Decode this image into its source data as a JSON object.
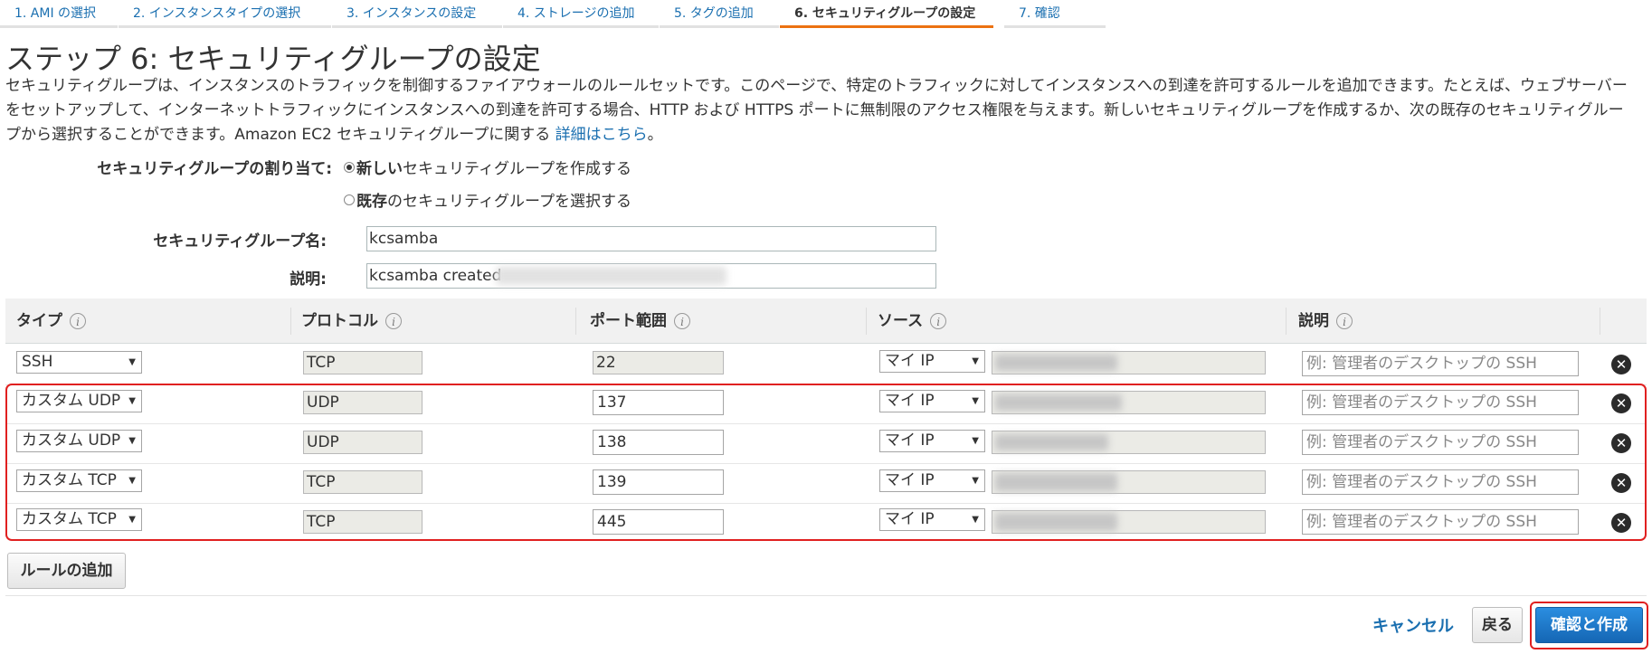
{
  "tabs": [
    {
      "label": "1. AMI の選択",
      "active": false
    },
    {
      "label": "2. インスタンスタイプの選択",
      "active": false
    },
    {
      "label": "3. インスタンスの設定",
      "active": false
    },
    {
      "label": "4. ストレージの追加",
      "active": false
    },
    {
      "label": "5. タグの追加",
      "active": false
    },
    {
      "label": "6. セキュリティグループの設定",
      "active": true
    },
    {
      "label": "7. 確認",
      "active": false
    }
  ],
  "page": {
    "title": "ステップ 6: セキュリティグループの設定",
    "intro": "セキュリティグループは、インスタンスのトラフィックを制御するファイアウォールのルールセットです。このページで、特定のトラフィックに対してインスタンスへの到達を許可するルールを追加できます。たとえば、ウェブサーバーをセットアップして、インターネットトラフィックにインスタンスへの到達を許可する場合、HTTP および HTTPS ポートに無制限のアクセス権限を与えます。新しいセキュリティグループを作成するか、次の既存のセキュリティグループから選択することができます。Amazon EC2 セキュリティグループに関する",
    "intro_link": "詳細はこちら",
    "intro_end": "。"
  },
  "form": {
    "assign_label": "セキュリティグループの割り当て:",
    "option_new_bold": "新しい",
    "option_new_rest": "セキュリティグループを作成する",
    "option_existing_bold": "既存",
    "option_existing_rest": "のセキュリティグループを選択する",
    "selected_option": "new",
    "name_label": "セキュリティグループ名:",
    "name_value": "kcsamba",
    "desc_label": "説明:",
    "desc_value": "kcsamba created"
  },
  "table": {
    "headers": {
      "type": "タイプ",
      "protocol": "プロトコル",
      "port_range": "ポート範囲",
      "source": "ソース",
      "description": "説明"
    },
    "info_glyph": "i",
    "rows": [
      {
        "type": "SSH",
        "protocol": "TCP",
        "port": "22",
        "source": "マイ IP",
        "desc_placeholder": "例: 管理者のデスクトップの SSH"
      },
      {
        "type": "カスタム UDP",
        "protocol": "UDP",
        "port": "137",
        "source": "マイ IP",
        "desc_placeholder": "例: 管理者のデスクトップの SSH"
      },
      {
        "type": "カスタム UDP",
        "protocol": "UDP",
        "port": "138",
        "source": "マイ IP",
        "desc_placeholder": "例: 管理者のデスクトップの SSH"
      },
      {
        "type": "カスタム TCP",
        "protocol": "TCP",
        "port": "139",
        "source": "マイ IP",
        "desc_placeholder": "例: 管理者のデスクトップの SSH"
      },
      {
        "type": "カスタム TCP",
        "protocol": "TCP",
        "port": "445",
        "source": "マイ IP",
        "desc_placeholder": "例: 管理者のデスクトップの SSH"
      }
    ]
  },
  "buttons": {
    "add_rule": "ルールの追加",
    "cancel": "キャンセル",
    "back": "戻る",
    "review_launch": "確認と作成"
  },
  "icons": {
    "caret": "▼",
    "delete": "✕",
    "info": "info-icon",
    "remove": "close-circle-icon"
  },
  "colors": {
    "link": "#1a6fb0",
    "active_tab_underline": "#ec7211",
    "primary_button": "#1d76c6",
    "highlight": "#e02020"
  }
}
